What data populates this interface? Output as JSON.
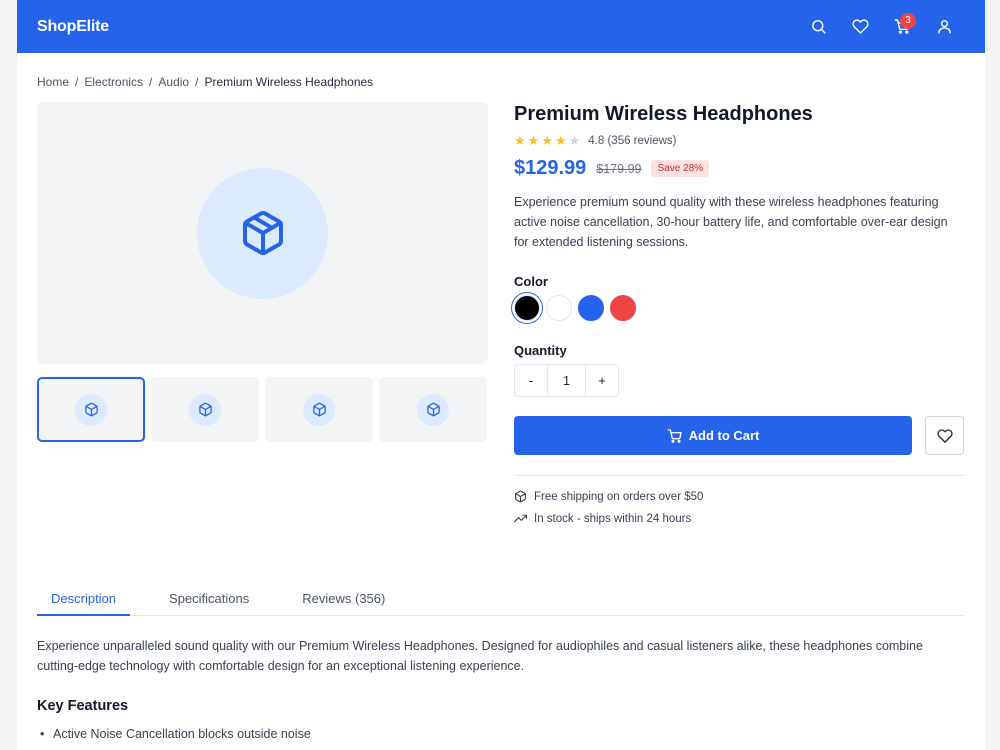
{
  "header": {
    "logo": "ShopElite",
    "cart_count": "3"
  },
  "breadcrumb": {
    "items": [
      "Home",
      "Electronics",
      "Audio"
    ],
    "separator": "/",
    "current": "Premium Wireless Headphones"
  },
  "gallery": {
    "main_icon": "package-icon",
    "thumbnails": [
      {
        "icon": "package-icon",
        "active": true
      },
      {
        "icon": "package-icon",
        "active": false
      },
      {
        "icon": "package-icon",
        "active": false
      },
      {
        "icon": "package-icon",
        "active": false
      }
    ]
  },
  "product": {
    "title": "Premium Wireless Headphones",
    "rating": 4.8,
    "rating_text": "4.8 (356 reviews)",
    "stars_filled": 4,
    "stars_total": 5,
    "price": "$129.99",
    "old_price": "$179.99",
    "save_label": "Save 28%",
    "description": "Experience premium sound quality with these wireless headphones featuring active noise cancellation, 30-hour battery life, and comfortable over-ear design for extended listening sessions."
  },
  "color_picker": {
    "label": "Color",
    "options": [
      {
        "name": "black",
        "hex": "#000000",
        "selected": true
      },
      {
        "name": "white",
        "hex": "#ffffff",
        "selected": false
      },
      {
        "name": "blue",
        "hex": "#2563eb",
        "selected": false
      },
      {
        "name": "red",
        "hex": "#ef4444",
        "selected": false
      }
    ]
  },
  "quantity": {
    "label": "Quantity",
    "decrement": "-",
    "value": "1",
    "increment": "+"
  },
  "actions": {
    "add_to_cart": "Add to Cart"
  },
  "perks": [
    {
      "icon": "package-icon",
      "text": "Free shipping on orders over $50"
    },
    {
      "icon": "trending-up-icon",
      "text": "In stock - ships within 24 hours"
    }
  ],
  "tabs": [
    {
      "label": "Description",
      "active": true
    },
    {
      "label": "Specifications",
      "active": false
    },
    {
      "label": "Reviews (356)",
      "active": false
    }
  ],
  "tab_content": {
    "paragraph": "Experience unparalleled sound quality with our Premium Wireless Headphones. Designed for audiophiles and casual listeners alike, these headphones combine cutting-edge technology with comfortable design for an exceptional listening experience.",
    "features_title": "Key Features",
    "features": [
      "Active Noise Cancellation blocks outside noise"
    ]
  },
  "colors": {
    "primary": "#2563eb",
    "accent_light": "#dbeafe",
    "badge_red": "#ef4444"
  }
}
